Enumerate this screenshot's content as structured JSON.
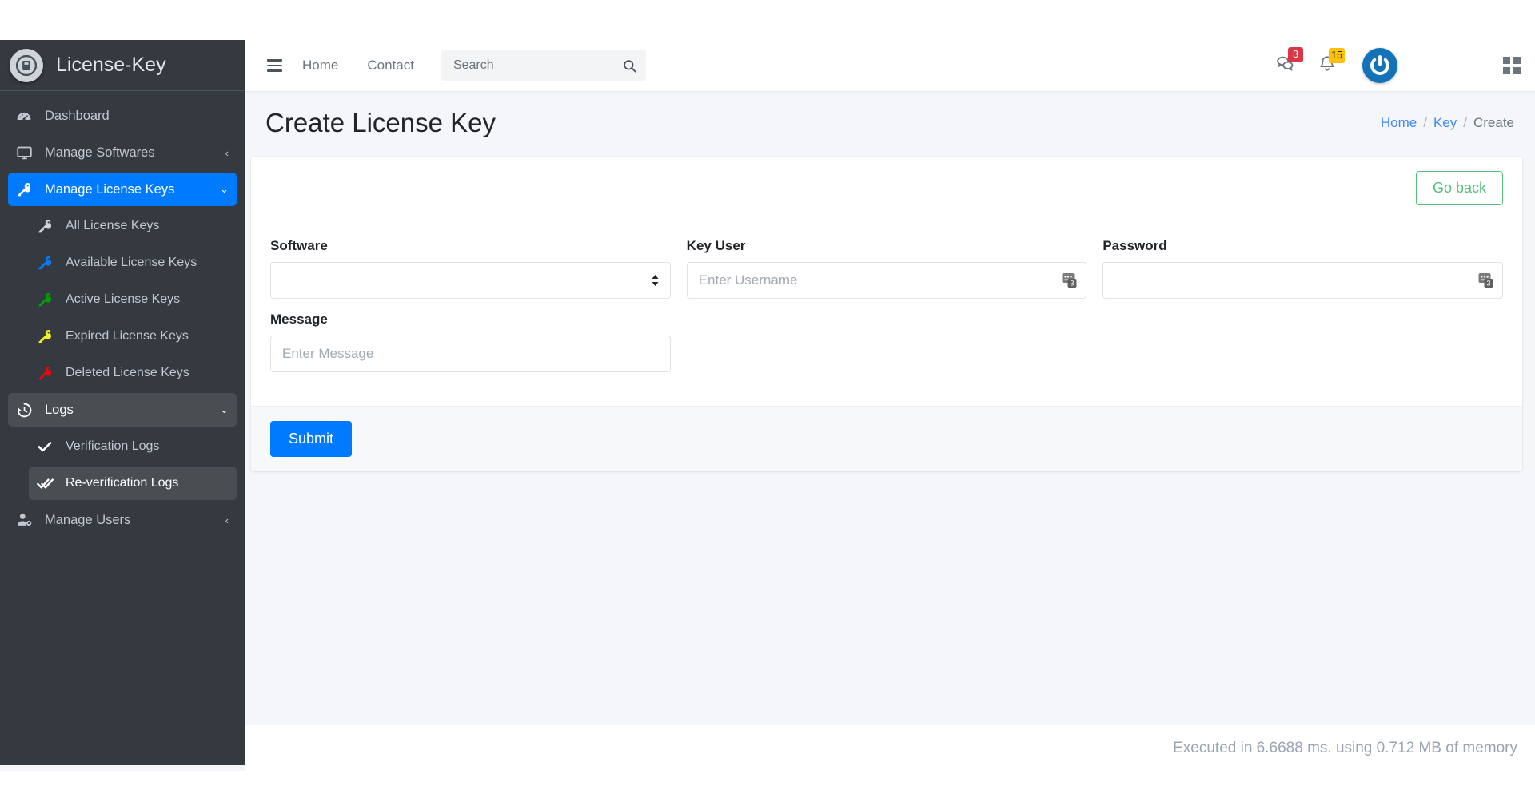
{
  "brand": {
    "name": "License-Key",
    "logo_icon": "app-logo-icon"
  },
  "sidebar": {
    "items": [
      {
        "label": "Dashboard",
        "icon": "dashboard-gauge-icon",
        "state": "normal",
        "arrow": "",
        "level": 1
      },
      {
        "label": "Manage Softwares",
        "icon": "monitor-icon",
        "state": "normal",
        "arrow": "‹",
        "level": 1
      },
      {
        "label": "Manage License Keys",
        "icon": "key-icon",
        "state": "active",
        "arrow": "⌄",
        "level": 1
      },
      {
        "label": "All License Keys",
        "icon": "key-icon-grey",
        "state": "normal",
        "arrow": "",
        "level": 2
      },
      {
        "label": "Available License Keys",
        "icon": "key-icon-blue",
        "state": "normal",
        "arrow": "",
        "level": 2
      },
      {
        "label": "Active License Keys",
        "icon": "key-icon-green",
        "state": "normal",
        "arrow": "",
        "level": 2
      },
      {
        "label": "Expired License Keys",
        "icon": "key-icon-yellow",
        "state": "normal",
        "arrow": "",
        "level": 2
      },
      {
        "label": "Deleted License Keys",
        "icon": "key-icon-red",
        "state": "normal",
        "arrow": "",
        "level": 2
      },
      {
        "label": "Logs",
        "icon": "history-clock-icon",
        "state": "open",
        "arrow": "⌄",
        "level": 1
      },
      {
        "label": "Verification Logs",
        "icon": "check-icon",
        "state": "normal",
        "arrow": "",
        "level": 2
      },
      {
        "label": "Re-verification Logs",
        "icon": "double-check-icon",
        "state": "selected",
        "arrow": "",
        "level": 2
      },
      {
        "label": "Manage Users",
        "icon": "user-cog-icon",
        "state": "normal",
        "arrow": "‹",
        "level": 1
      }
    ]
  },
  "navbar": {
    "menu_toggle_icon": "hamburger-icon",
    "links": [
      {
        "label": "Home"
      },
      {
        "label": "Contact"
      }
    ],
    "search": {
      "placeholder": "Search",
      "value": "",
      "icon": "search-icon"
    },
    "messages": {
      "icon": "chat-icon",
      "count": "3",
      "color": "#dc3545"
    },
    "notifications": {
      "icon": "bell-icon",
      "count": "15",
      "color": "#ffc107"
    },
    "user": {
      "icon": "power-avatar-icon",
      "color": "#1273b8"
    },
    "apps": {
      "icon": "grid-apps-icon"
    }
  },
  "page": {
    "title": "Create License Key",
    "breadcrumb": [
      {
        "label": "Home",
        "link": true
      },
      {
        "label": "Key",
        "link": true
      },
      {
        "label": "Create",
        "link": false
      }
    ],
    "separator": "/"
  },
  "card": {
    "go_back_label": "Go back",
    "submit_label": "Submit",
    "fields": {
      "software": {
        "label": "Software",
        "type": "select",
        "selected": "",
        "options": [
          ""
        ]
      },
      "key_user": {
        "label": "Key User",
        "type": "text",
        "placeholder": "Enter Username",
        "value": "",
        "addon_icon": "password-manager-icon",
        "addon_count": "3"
      },
      "password": {
        "label": "Password",
        "type": "password",
        "placeholder": "",
        "value": "",
        "addon_icon": "password-manager-icon",
        "addon_count": "3"
      },
      "message": {
        "label": "Message",
        "type": "text",
        "placeholder": "Enter Message",
        "value": ""
      }
    }
  },
  "footer": {
    "text": "Executed in 6.6688 ms. using 0.712 MB of memory"
  },
  "colors": {
    "primary": "#007bff",
    "sidebar_bg": "#343a40",
    "success_outline": "#54c07b",
    "danger": "#dc3545",
    "warning": "#ffc107"
  }
}
